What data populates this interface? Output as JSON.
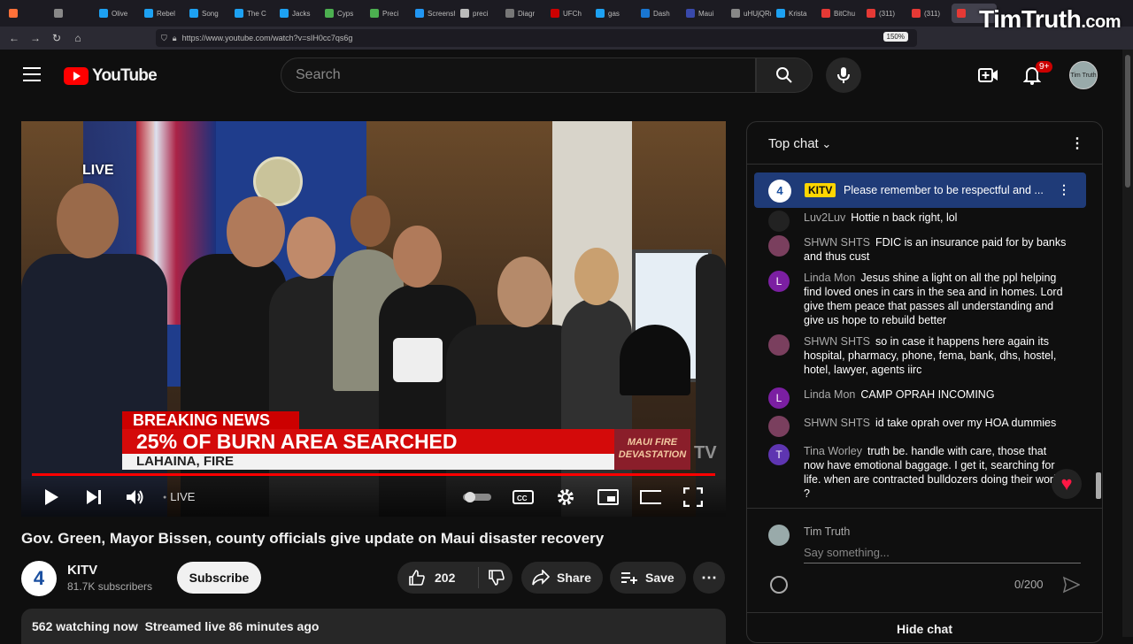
{
  "browser": {
    "tabs": [
      "",
      "",
      "Olive",
      "Rebel",
      "Song",
      "The C",
      "Jacks",
      "Cyps",
      "Preci",
      "Screensh",
      "preci",
      "Diagr",
      "UFCh",
      "gas",
      "Dash",
      "Maui",
      "uHUjQRm",
      "Krista",
      "BitChu",
      "(311)",
      "(311)",
      ""
    ],
    "url": "https://www.youtube.com/watch?v=sIH0cc7qs6g",
    "zoom": "150%",
    "brand_text": "TimTruth",
    "brand_suffix": ".com"
  },
  "header": {
    "logo_text": "YouTube",
    "search_placeholder": "Search",
    "notification_count": "9+",
    "avatar_label": "Tim Truth"
  },
  "video": {
    "live_badge": "LIVE",
    "breaking_label": "BREAKING NEWS",
    "headline": "25% OF BURN AREA SEARCHED",
    "subline": "LAHAINA, FIRE",
    "tag_line1": "MAUI FIRE",
    "tag_line2": "DEVASTATION",
    "station_watermark": "TV",
    "controls_live": "LIVE",
    "progress": 1.0
  },
  "info": {
    "title": "Gov. Green, Mayor Bissen, county officials give update on Maui disaster recovery",
    "channel_name": "KITV",
    "channel_avatar": "4",
    "subscribers": "81.7K subscribers",
    "subscribe_label": "Subscribe",
    "likes": "202",
    "share_label": "Share",
    "save_label": "Save",
    "watching": "562 watching now",
    "streamed": "Streamed live 86 minutes ago"
  },
  "chat": {
    "header_label": "Top chat",
    "pinned": {
      "avatar": "4",
      "tag": "KITV",
      "text": "Please remember to be respectful and ..."
    },
    "messages": [
      {
        "author": "Luv2Luv",
        "text": "Hottie n back right, lol",
        "avatar_color": "#222222",
        "avatar_letter": ""
      },
      {
        "author": "SHWN SHTS",
        "text": "FDIC is an insurance paid for by banks and thus cust",
        "avatar_color": "#7a3f5e",
        "avatar_letter": ""
      },
      {
        "author": "Linda Mon",
        "text": "Jesus shine a light on all the ppl helping find loved ones in cars in the sea and in homes. Lord give them peace that passes all understanding and give us hope to rebuild better",
        "avatar_color": "#7b1fa2",
        "avatar_letter": "L"
      },
      {
        "author": "SHWN SHTS",
        "text": "so in case it happens here again its hospital, pharmacy, phone, fema, bank, dhs, hostel, hotel, lawyer, agents iirc",
        "avatar_color": "#7a3f5e",
        "avatar_letter": ""
      },
      {
        "author": "Linda Mon",
        "text": "CAMP OPRAH INCOMING",
        "avatar_color": "#7b1fa2",
        "avatar_letter": "L"
      },
      {
        "author": "SHWN SHTS",
        "text": "id take oprah over my HOA dummies",
        "avatar_color": "#7a3f5e",
        "avatar_letter": ""
      },
      {
        "author": "Tina Worley",
        "text": "truth be. handle with care, those that now have emotional baggage. I get it, searching for life. when are contracted bulldozers doing their work. ?",
        "avatar_color": "#5e35b1",
        "avatar_letter": "T"
      }
    ],
    "input_name": "Tim Truth",
    "input_placeholder": "Say something...",
    "char_count": "0/200",
    "hide_label": "Hide chat"
  }
}
